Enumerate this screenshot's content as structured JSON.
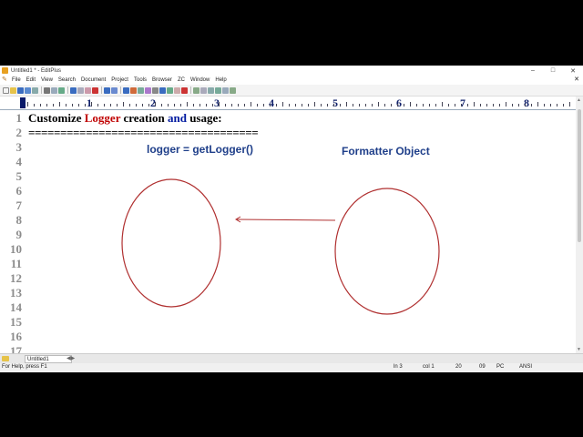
{
  "window": {
    "title": "Untitled1 * - EditPlus",
    "minimize": "–",
    "maximize": "□",
    "close": "✕"
  },
  "menu": {
    "items": [
      "File",
      "Edit",
      "View",
      "Search",
      "Document",
      "Project",
      "Tools",
      "Browser",
      "ZC",
      "Window",
      "Help"
    ],
    "close": "✕"
  },
  "ruler": {
    "numbers": [
      "1",
      "2",
      "3",
      "4",
      "5",
      "6",
      "7",
      "8"
    ]
  },
  "gutter": {
    "lines": [
      "1",
      "2",
      "3",
      "4",
      "5",
      "6",
      "7",
      "8",
      "9",
      "10",
      "11",
      "12",
      "13",
      "14",
      "15",
      "16",
      "17"
    ]
  },
  "editor": {
    "line1": [
      {
        "text": "Customize ",
        "color": "black"
      },
      {
        "text": "Logger",
        "color": "red"
      },
      {
        "text": " creation ",
        "color": "black"
      },
      {
        "text": "and",
        "color": "blue"
      },
      {
        "text": " usage:",
        "color": "black"
      }
    ],
    "line2": "===================================="
  },
  "drawing": {
    "label_left": "logger = getLogger()",
    "label_right": "Formatter Object",
    "stroke_color": "#b03030"
  },
  "tabs": [
    {
      "label": "Untitled1"
    }
  ],
  "status": {
    "help": "For Help, press F1",
    "line": "ln 3",
    "col": "col 1",
    "val1": "20",
    "val2": "09",
    "mode": "PC",
    "encoding": "ANSI"
  }
}
